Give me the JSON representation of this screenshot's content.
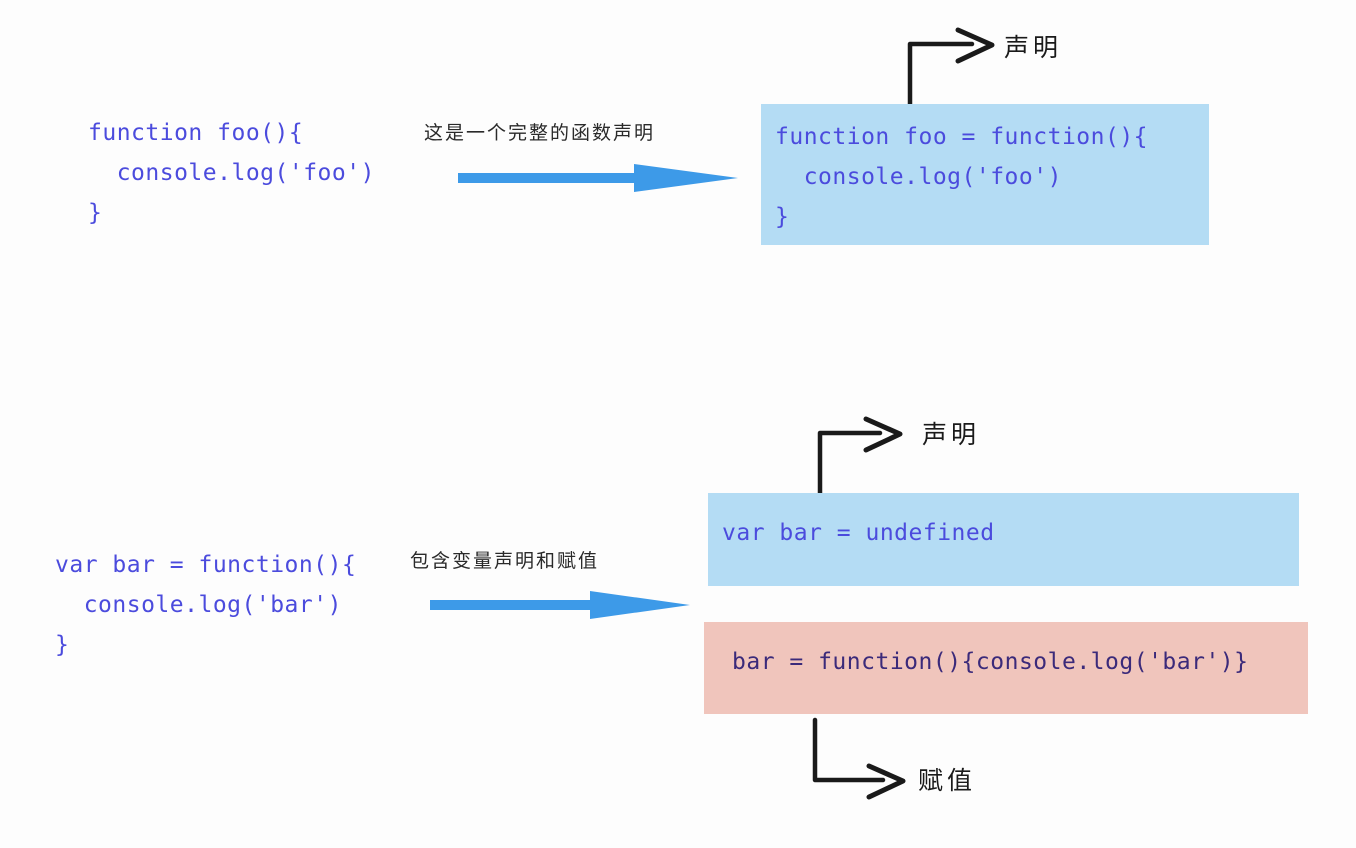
{
  "diagram": {
    "title_context": "JavaScript function declaration vs function expression hoisting",
    "background_color": "#fdfdfd",
    "colors": {
      "code_blue": "#4b4bdd",
      "code_dark_purple": "#3b2a7a",
      "panel_blue": "#b4dcf4",
      "panel_pink": "#f0c5bc",
      "arrow_blue": "#3d9ae8",
      "ink_black": "#1a1a1a"
    }
  },
  "section_top": {
    "source_code": "function foo(){\n  console.log('foo')\n}",
    "transform_note": "这是一个完整的函数声明",
    "result_code": "function foo = function(){\n  console.log('foo')\n}",
    "callout_label": "声明"
  },
  "section_bottom": {
    "source_code": "var bar = function(){\n  console.log('bar')\n}",
    "transform_note": "包含变量声明和赋值",
    "result_declaration_code": "var bar = undefined",
    "result_assignment_code": "bar = function(){console.log('bar')}",
    "callout_label_declaration": "声明",
    "callout_label_assignment": "赋值"
  },
  "icons": {
    "blue_transform_arrow": "right-arrow-icon",
    "elbow_callout_arrow": "elbow-arrow-icon"
  }
}
